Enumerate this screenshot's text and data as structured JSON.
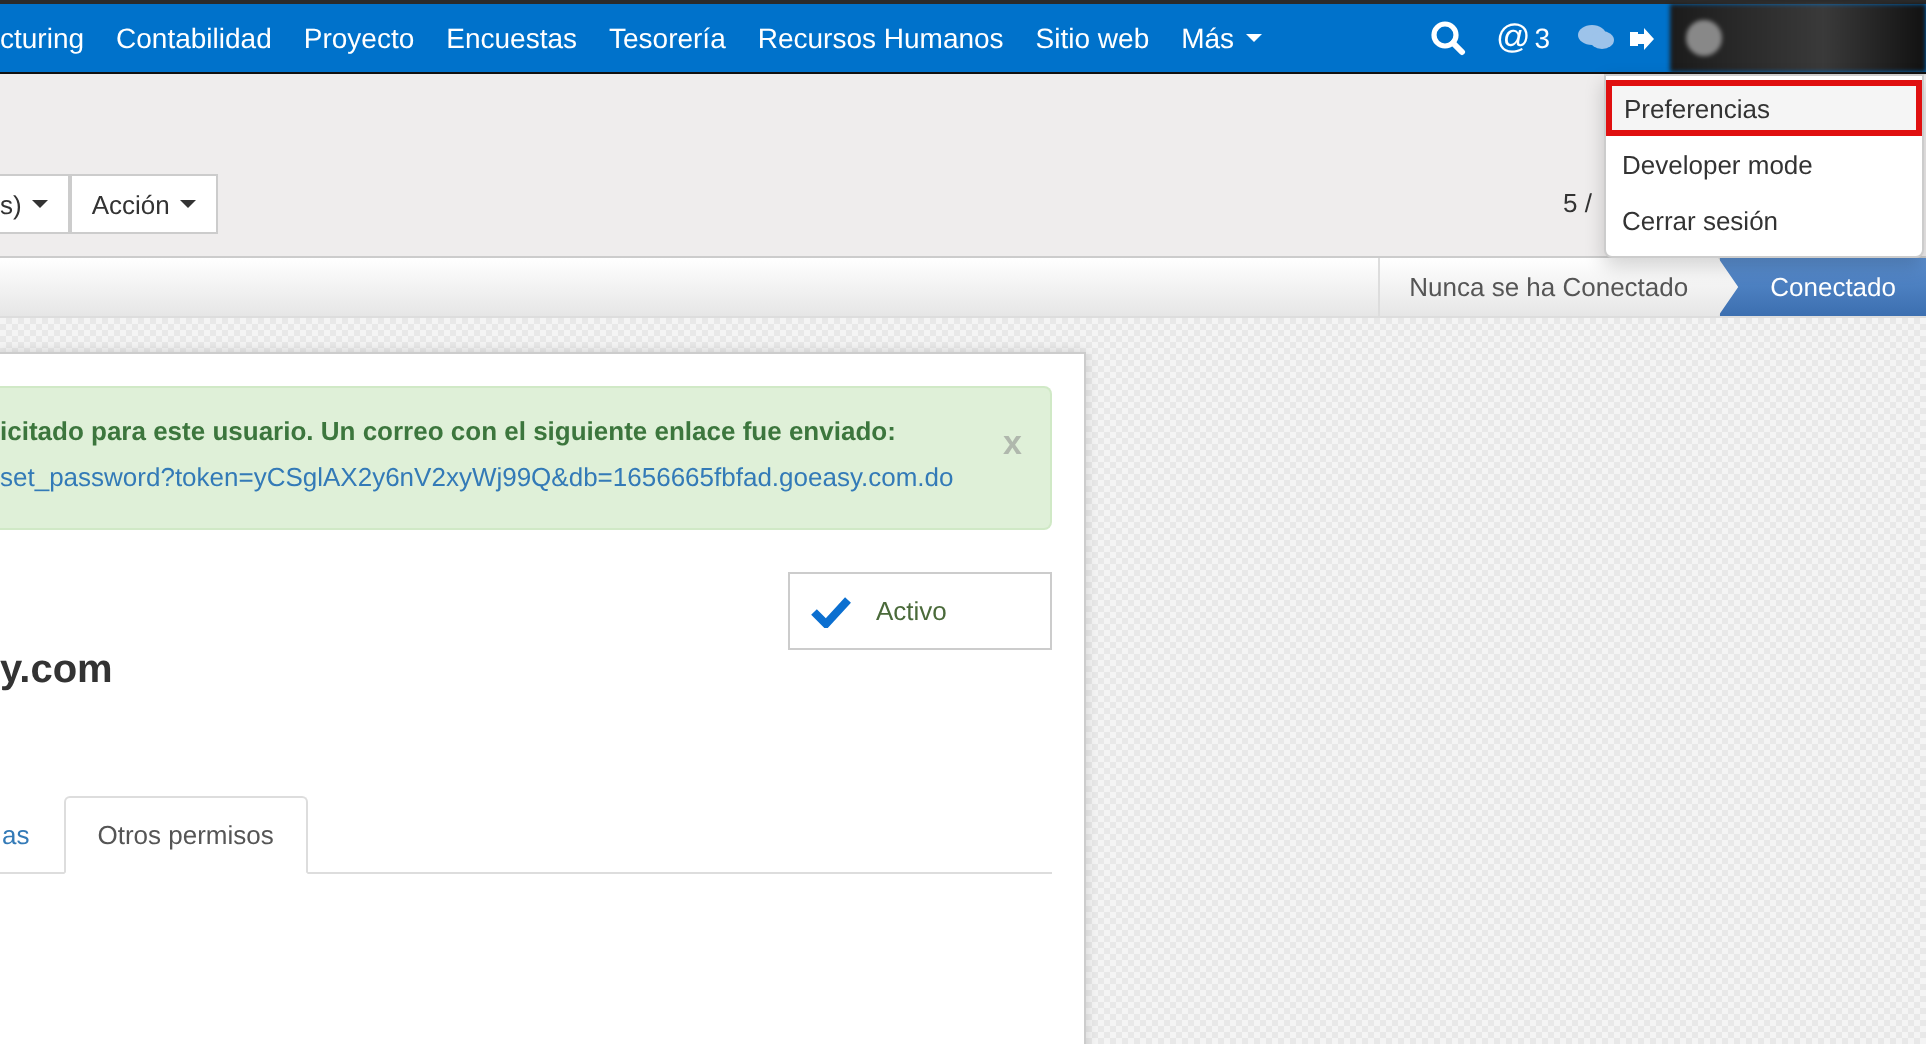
{
  "nav": {
    "items": [
      "cturing",
      "Contabilidad",
      "Proyecto",
      "Encuestas",
      "Tesorería",
      "Recursos Humanos",
      "Sitio web"
    ],
    "more": "Más",
    "mention_symbol": "@",
    "mentions": "3"
  },
  "user_menu": {
    "items": [
      {
        "label": "Preferencias",
        "selected": true
      },
      {
        "label": "Developer mode",
        "selected": false
      },
      {
        "label": "Cerrar sesión",
        "selected": false
      }
    ]
  },
  "control_panel": {
    "buttons": [
      "s)",
      "Acción"
    ],
    "pager": "5 /"
  },
  "status_bar": {
    "stages": [
      {
        "label": "Nunca se ha Conectado",
        "selected": false
      },
      {
        "label": "Conectado",
        "selected": true
      }
    ]
  },
  "form": {
    "alert": {
      "message": "icitado para este usuario. Un correo con el siguiente enlace fue enviado:",
      "link": "set_password?token=yCSglAX2y6nV2xyWj99Q&db=1656665fbfad.goeasy.com.do",
      "close": "x"
    },
    "active_toggle": {
      "label": "Activo",
      "on": true
    },
    "title": "y.com",
    "tabs": [
      {
        "label": "as",
        "selected": false
      },
      {
        "label": "Otros permisos",
        "selected": true
      }
    ]
  }
}
